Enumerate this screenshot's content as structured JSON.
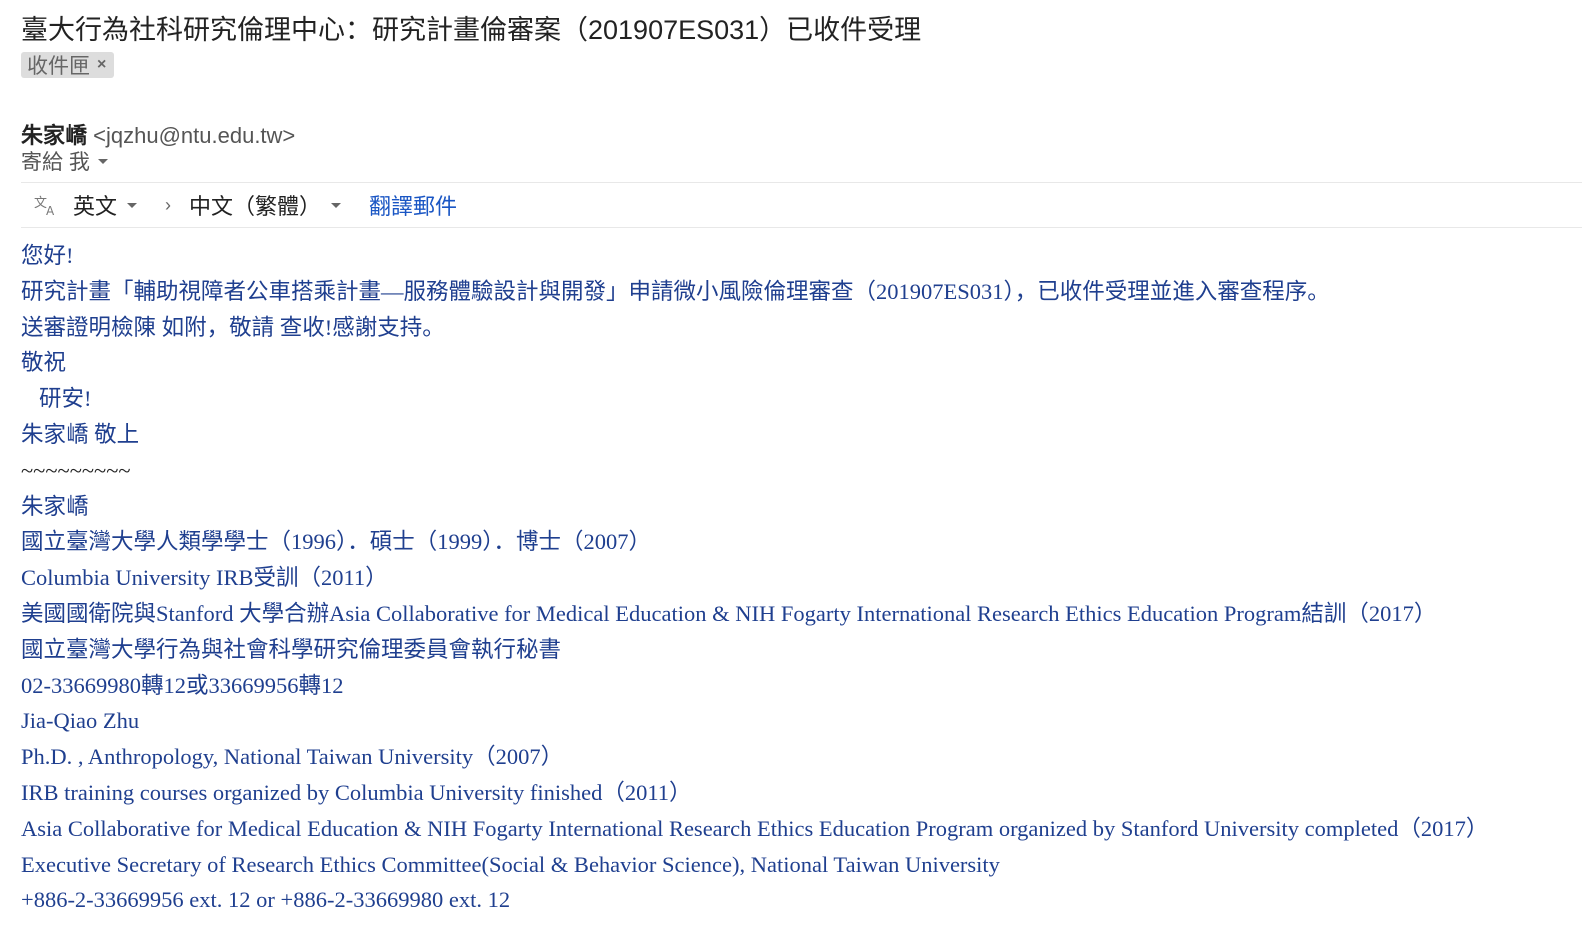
{
  "email": {
    "subject": "臺大行為社科研究倫理中心：研究計畫倫審案（201907ES031）已收件受理",
    "label": "收件匣",
    "label_close": "×",
    "sender_name": "朱家嶠",
    "sender_email": "<jqzhu@ntu.edu.tw>",
    "recipient": "寄給 我",
    "recipient_icon": "chevron-down-icon"
  },
  "translate_bar": {
    "icon": "translate-icon",
    "source_lang": "英文",
    "arrow": "›",
    "target_lang": "中文（繁體）",
    "translate_link": "翻譯郵件"
  },
  "body": {
    "greeting": "您好!",
    "line1": "研究計畫「輔助視障者公車搭乘計畫—服務體驗設計與開發」申請微小風險倫理審查（201907ES031），已收件受理並進入審查程序。",
    "line2": "送審證明檢陳 如附，敬請 查收!感謝支持。",
    "closing1": "敬祝",
    "closing2": "研安!",
    "sign": "朱家嶠 敬上",
    "separator": "~~~~~~~~~",
    "signature": [
      "朱家嶠",
      "國立臺灣大學人類學學士（1996）．碩士（1999）．博士（2007）",
      "Columbia University IRB受訓（2011）",
      "美國國衛院與Stanford 大學合辦Asia Collaborative for Medical Education & NIH Fogarty International Research Ethics Education Program結訓（2017）",
      "國立臺灣大學行為與社會科學研究倫理委員會執行秘書",
      "02-33669980轉12或33669956轉12",
      "Jia-Qiao Zhu",
      "Ph.D. , Anthropology, National Taiwan University（2007）",
      "IRB training courses organized by Columbia University finished（2011）",
      "Asia Collaborative for Medical Education & NIH Fogarty International Research Ethics Education Program organized by Stanford University completed（2017）",
      "Executive Secretary of Research Ethics Committee(Social & Behavior Science), National Taiwan University",
      "+886-2-33669956 ext. 12 or +886-2-33669980 ext. 12"
    ]
  },
  "colors": {
    "body_text": "#1f3f8f",
    "link": "#1a56c4",
    "chip_bg": "#dddddd"
  }
}
